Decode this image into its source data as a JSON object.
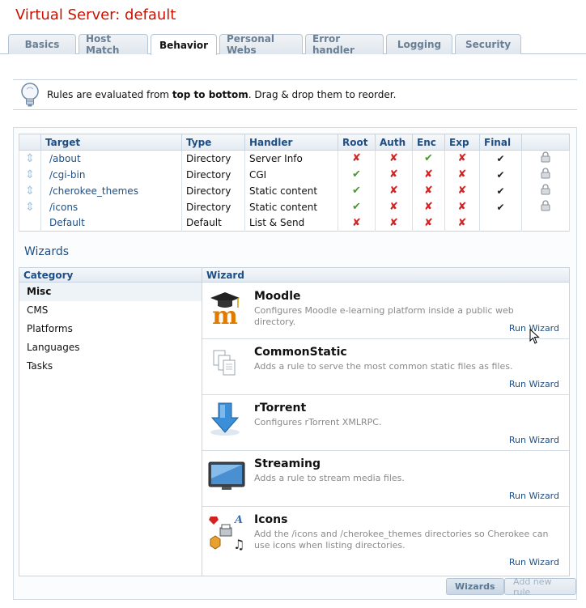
{
  "title": "Virtual Server: default",
  "tabs": [
    "Basics",
    "Host Match",
    "Behavior",
    "Personal Webs",
    "Error handler",
    "Logging",
    "Security"
  ],
  "active_tab": "Behavior",
  "info": {
    "prefix": "Rules are evaluated from ",
    "bold": "top to bottom",
    "suffix": ". Drag & drop them to reorder."
  },
  "rules_table": {
    "columns": [
      "Target",
      "Type",
      "Handler",
      "Root",
      "Auth",
      "Enc",
      "Exp",
      "Final"
    ],
    "rows": [
      {
        "target": "/about",
        "type": "Directory",
        "handler": "Server Info",
        "root": "x",
        "auth": "x",
        "enc": "ok",
        "exp": "x",
        "final": "✔",
        "draggable": true,
        "lock": true
      },
      {
        "target": "/cgi-bin",
        "type": "Directory",
        "handler": "CGI",
        "root": "ok",
        "auth": "x",
        "enc": "x",
        "exp": "x",
        "final": "✔",
        "draggable": true,
        "lock": true
      },
      {
        "target": "/cherokee_themes",
        "type": "Directory",
        "handler": "Static content",
        "root": "ok",
        "auth": "x",
        "enc": "x",
        "exp": "x",
        "final": "✔",
        "draggable": true,
        "lock": true
      },
      {
        "target": "/icons",
        "type": "Directory",
        "handler": "Static content",
        "root": "ok",
        "auth": "x",
        "enc": "x",
        "exp": "x",
        "final": "✔",
        "draggable": true,
        "lock": true
      },
      {
        "target": "Default",
        "type": "Default",
        "handler": "List & Send",
        "root": "x",
        "auth": "x",
        "enc": "x",
        "exp": "x",
        "final": "",
        "draggable": false,
        "lock": false
      }
    ]
  },
  "wizards": {
    "title": "Wizards",
    "category_header": "Category",
    "wizard_header": "Wizard",
    "categories": [
      "Misc",
      "CMS",
      "Platforms",
      "Languages",
      "Tasks"
    ],
    "selected_category": "Misc",
    "items": [
      {
        "name": "Moodle",
        "desc": "Configures Moodle e-learning platform inside a public web directory.",
        "run": "Run Wizard",
        "icon": "moodle-icon"
      },
      {
        "name": "CommonStatic",
        "desc": "Adds a rule to serve the most common static files as files.",
        "run": "Run Wizard",
        "icon": "static-files-icon"
      },
      {
        "name": "rTorrent",
        "desc": "Configures rTorrent XMLRPC.",
        "run": "Run Wizard",
        "icon": "download-arrow-icon"
      },
      {
        "name": "Streaming",
        "desc": "Adds a rule to stream media files.",
        "run": "Run Wizard",
        "icon": "monitor-icon"
      },
      {
        "name": "Icons",
        "desc": "Add the /icons and /cherokee_themes directories so Cherokee can use icons when listing directories.",
        "run": "Run Wizard",
        "icon": "icons-collection-icon"
      }
    ]
  },
  "buttons": {
    "wizards": "Wizards",
    "add_rule": "Add new rule"
  },
  "colors": {
    "title": "#cc1100",
    "link": "#1d4f86",
    "error": "#d42222",
    "success": "#4a9a2c"
  }
}
